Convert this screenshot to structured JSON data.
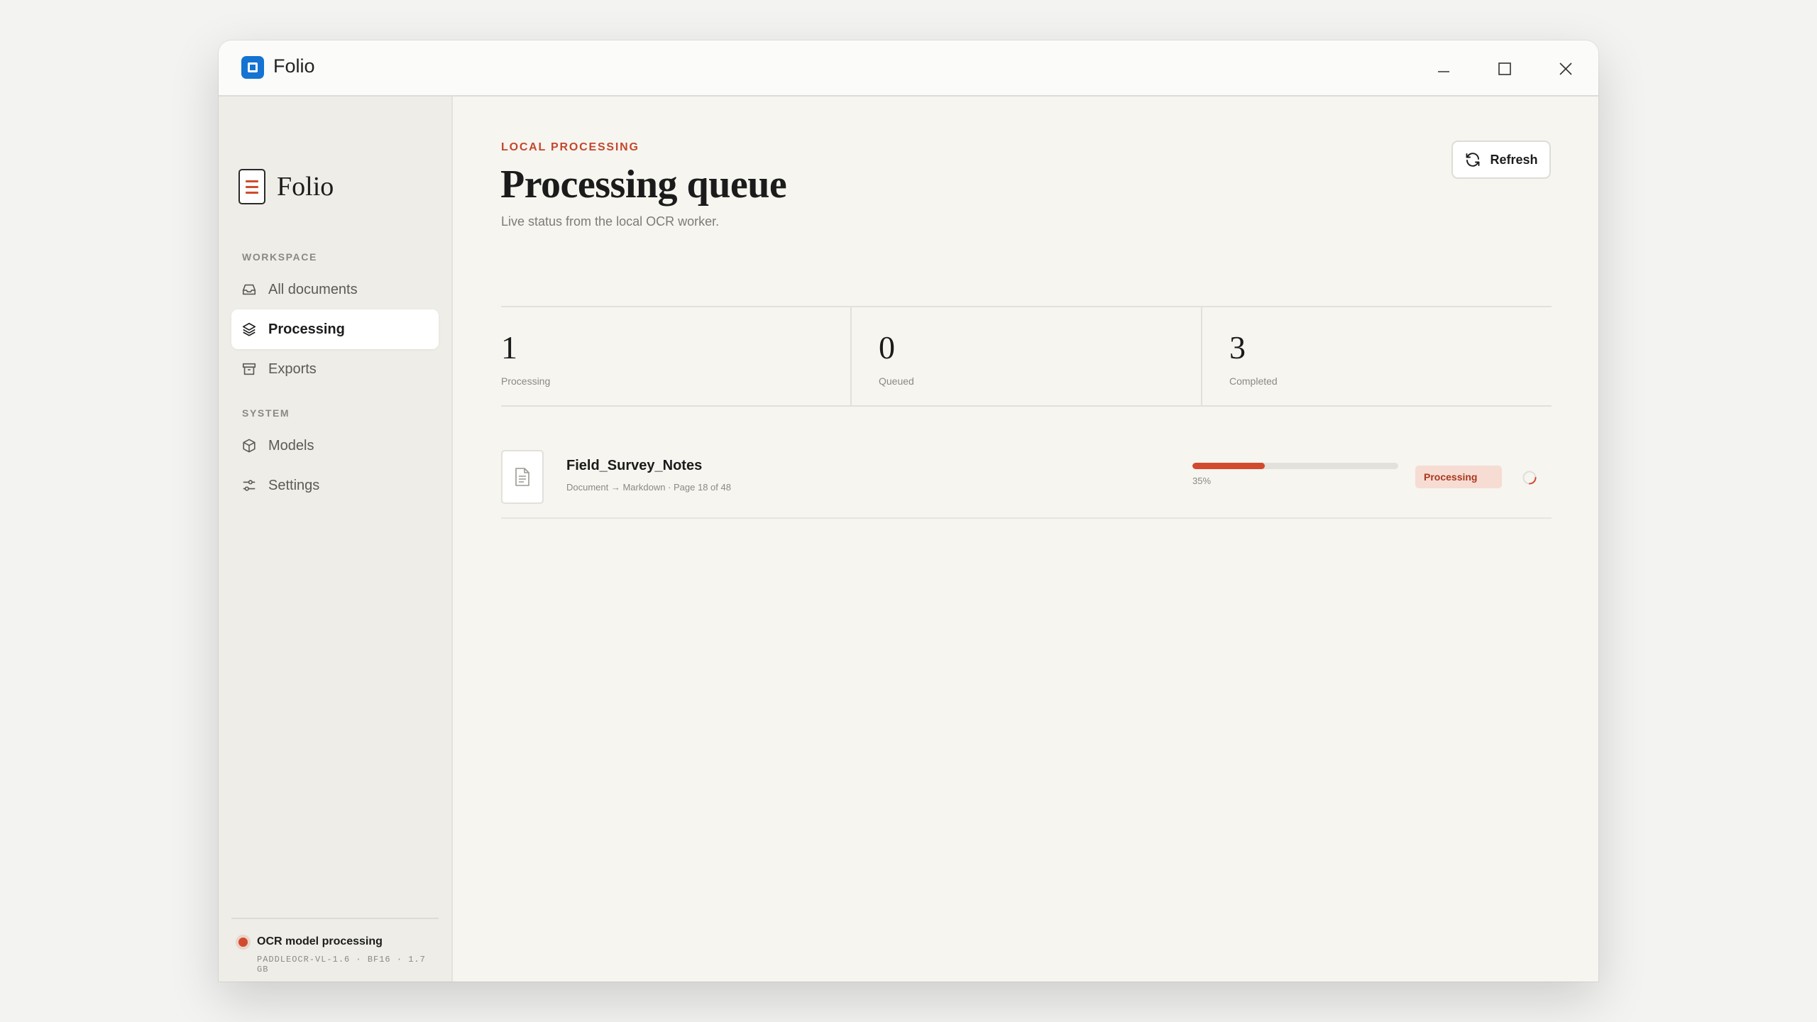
{
  "window": {
    "title": "Folio"
  },
  "sidebar": {
    "brand": "Folio",
    "sections": [
      {
        "label": "WORKSPACE"
      },
      {
        "label": "SYSTEM"
      }
    ],
    "items": [
      {
        "label": "All documents",
        "icon": "inbox-icon"
      },
      {
        "label": "Processing",
        "icon": "layers-icon",
        "active": true
      },
      {
        "label": "Exports",
        "icon": "archive-icon"
      },
      {
        "label": "Models",
        "icon": "cube-icon"
      },
      {
        "label": "Settings",
        "icon": "sliders-icon"
      }
    ],
    "status": {
      "title": "OCR model processing",
      "detail": "PADDLEOCR-VL-1.6 · BF16 · 1.7 GB"
    }
  },
  "header": {
    "eyebrow": "LOCAL PROCESSING",
    "title": "Processing queue",
    "subtitle": "Live status from the local OCR worker.",
    "refresh_label": "Refresh"
  },
  "stats": [
    {
      "value": "1",
      "label": "Processing"
    },
    {
      "value": "0",
      "label": "Queued"
    },
    {
      "value": "3",
      "label": "Completed"
    }
  ],
  "jobs": [
    {
      "name": "Field_Survey_Notes",
      "meta": "Document → Markdown · Page 18 of 48",
      "progress": 0.35,
      "progress_label": "35%",
      "status": "Processing"
    }
  ],
  "colors": {
    "accent": "#d24a2d",
    "app_icon": "#1573d1",
    "badge_bg": "#f7dcd3"
  }
}
